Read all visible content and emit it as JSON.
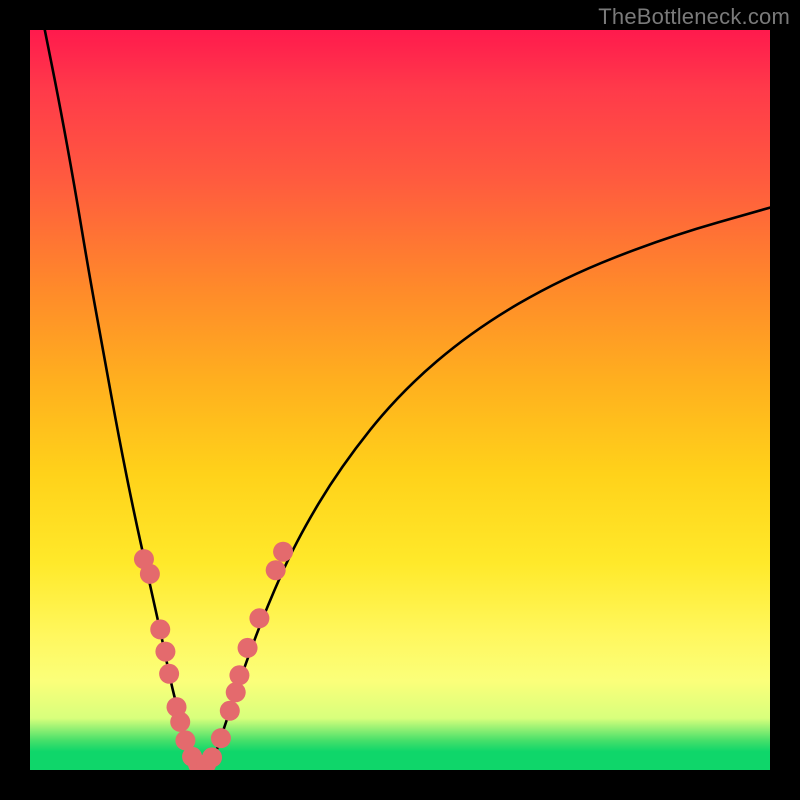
{
  "watermark": "TheBottleneck.com",
  "colors": {
    "dot_fill": "#e46a6d",
    "curve_stroke": "#000000",
    "gradient_top": "#ff1a4d",
    "gradient_bottom": "#0fd66a",
    "background": "#000000"
  },
  "chart_data": {
    "type": "line",
    "title": "",
    "xlabel": "",
    "ylabel": "",
    "xlim": [
      0,
      100
    ],
    "ylim": [
      0,
      100
    ],
    "series": [
      {
        "name": "left-branch",
        "x": [
          2,
          4,
          6,
          8,
          10,
          12,
          14,
          16,
          18,
          19,
          20,
          21,
          22,
          22.7
        ],
        "y": [
          100,
          90,
          79,
          67,
          56,
          45,
          35,
          26,
          17,
          12,
          8,
          4.5,
          2,
          0
        ]
      },
      {
        "name": "right-branch",
        "x": [
          24.3,
          25,
          26,
          27,
          29,
          32,
          36,
          42,
          50,
          60,
          72,
          86,
          100
        ],
        "y": [
          0,
          2,
          5,
          8,
          14,
          22,
          31,
          41,
          51,
          59.5,
          66.5,
          72,
          76
        ]
      }
    ],
    "scatter": {
      "name": "markers",
      "points": [
        {
          "x": 15.4,
          "y": 28.5
        },
        {
          "x": 16.2,
          "y": 26.5
        },
        {
          "x": 17.6,
          "y": 19.0
        },
        {
          "x": 18.3,
          "y": 16.0
        },
        {
          "x": 18.8,
          "y": 13.0
        },
        {
          "x": 19.8,
          "y": 8.5
        },
        {
          "x": 20.3,
          "y": 6.5
        },
        {
          "x": 21.0,
          "y": 4.0
        },
        {
          "x": 21.9,
          "y": 1.8
        },
        {
          "x": 22.7,
          "y": 0.8
        },
        {
          "x": 23.8,
          "y": 0.8
        },
        {
          "x": 24.6,
          "y": 1.7
        },
        {
          "x": 25.8,
          "y": 4.3
        },
        {
          "x": 27.0,
          "y": 8.0
        },
        {
          "x": 27.8,
          "y": 10.5
        },
        {
          "x": 28.3,
          "y": 12.8
        },
        {
          "x": 29.4,
          "y": 16.5
        },
        {
          "x": 31.0,
          "y": 20.5
        },
        {
          "x": 33.2,
          "y": 27.0
        },
        {
          "x": 34.2,
          "y": 29.5
        }
      ],
      "radius_css_px": 10
    },
    "annotations": []
  }
}
